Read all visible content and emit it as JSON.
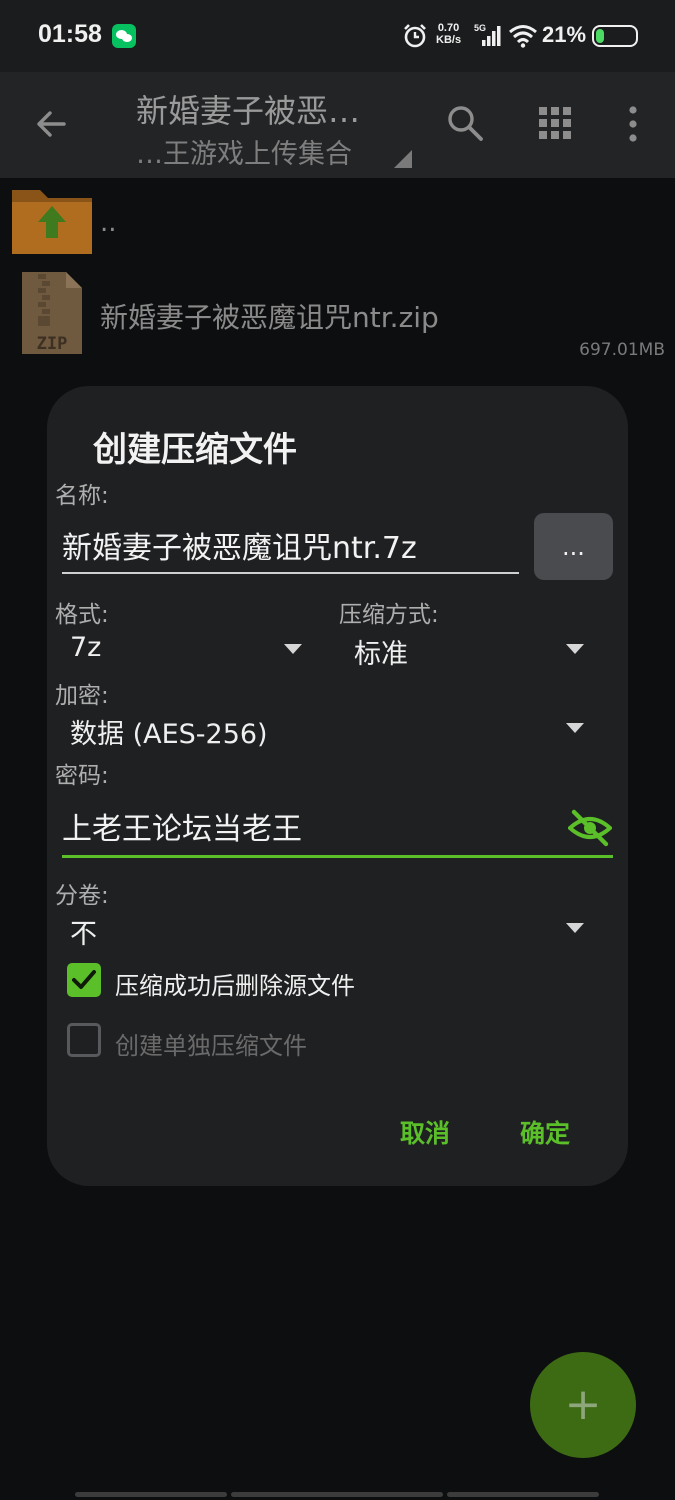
{
  "statusbar": {
    "time": "01:58",
    "net_speed_value": "0.70",
    "net_speed_unit": "KB/s",
    "network": "5G",
    "battery": "21%",
    "battery_level": 0.21
  },
  "toolbar": {
    "title": "新婚妻子被恶…",
    "subtitle": "…王游戏上传集合"
  },
  "files": {
    "parent_label": "..",
    "zip_icon_label": "ZIP",
    "zip_name": "新婚妻子被恶魔诅咒ntr.zip",
    "zip_size": "697.01MB"
  },
  "dialog": {
    "title": "创建压缩文件",
    "name_label": "名称:",
    "name_value": "新婚妻子被恶魔诅咒ntr.7z",
    "browse_label": "...",
    "format_label": "格式:",
    "format_value": "7z",
    "method_label": "压缩方式:",
    "method_value": "标准",
    "encrypt_label": "加密:",
    "encrypt_value": "数据 (AES-256)",
    "password_label": "密码:",
    "password_value": "上老王论坛当老王",
    "split_label": "分卷:",
    "split_value": "不",
    "delete_source_label": "压缩成功后删除源文件",
    "delete_source_checked": true,
    "separate_label": "创建单独压缩文件",
    "separate_checked": false,
    "cancel_label": "取消",
    "ok_label": "确定"
  },
  "fab": {
    "symbol": "+"
  },
  "colors": {
    "accent": "#5bbf2a",
    "dialog_bg": "#1f2022",
    "background": "#0d0e10"
  }
}
